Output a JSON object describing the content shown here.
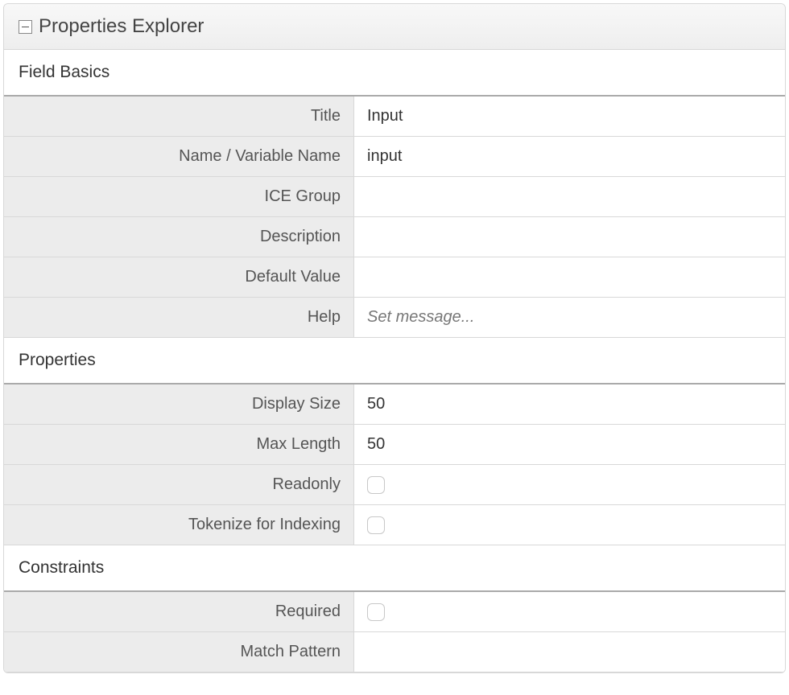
{
  "panel": {
    "title": "Properties Explorer"
  },
  "sections": {
    "fieldBasics": {
      "header": "Field Basics",
      "rows": {
        "title": {
          "label": "Title",
          "value": "Input"
        },
        "name": {
          "label": "Name / Variable Name",
          "value": "input"
        },
        "iceGroup": {
          "label": "ICE Group",
          "value": ""
        },
        "description": {
          "label": "Description",
          "value": ""
        },
        "defaultValue": {
          "label": "Default Value",
          "value": ""
        },
        "help": {
          "label": "Help",
          "placeholder": "Set message..."
        }
      }
    },
    "properties": {
      "header": "Properties",
      "rows": {
        "displaySize": {
          "label": "Display Size",
          "value": "50"
        },
        "maxLength": {
          "label": "Max Length",
          "value": "50"
        },
        "readonly": {
          "label": "Readonly",
          "checked": false
        },
        "tokenize": {
          "label": "Tokenize for Indexing",
          "checked": false
        }
      }
    },
    "constraints": {
      "header": "Constraints",
      "rows": {
        "required": {
          "label": "Required",
          "checked": false
        },
        "matchPattern": {
          "label": "Match Pattern",
          "value": ""
        }
      }
    }
  }
}
